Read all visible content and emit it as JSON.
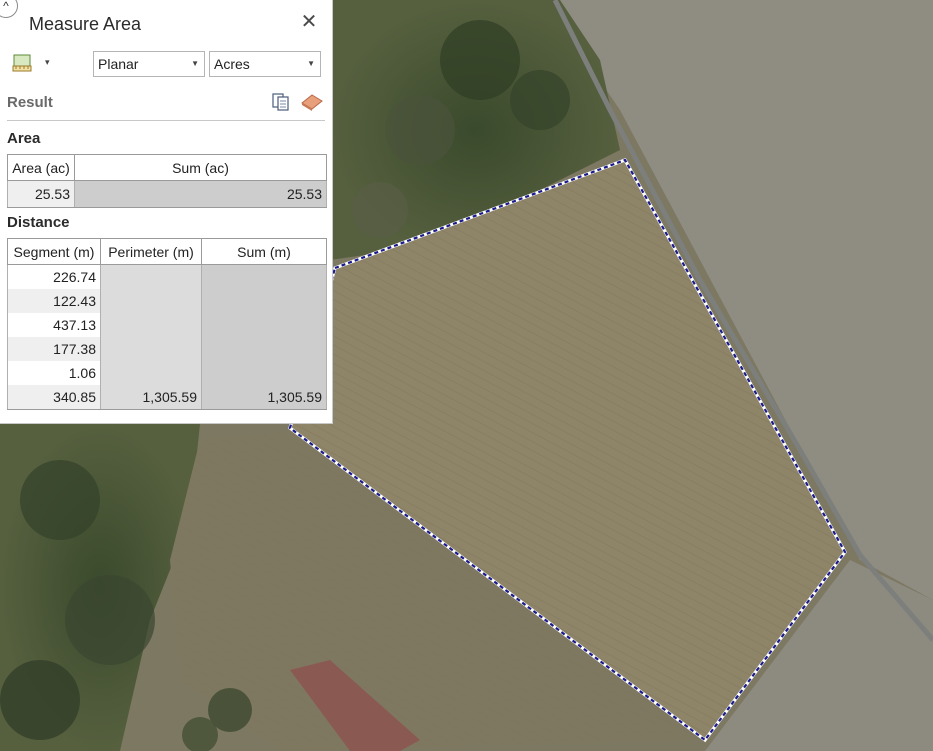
{
  "panel": {
    "title": "Measure Area",
    "close_glyph": "✕",
    "collapse_glyph": "^",
    "tool_icon": "measure-area-tool-icon",
    "method": "Planar",
    "units": "Acres",
    "result_label": "Result",
    "copy_icon": "copy-icon",
    "clear_icon": "eraser-icon"
  },
  "area": {
    "label": "Area",
    "columns": [
      "Area (ac)",
      "Sum (ac)"
    ],
    "rows": [
      {
        "area": "25.53",
        "sum": "25.53"
      }
    ]
  },
  "distance": {
    "label": "Distance",
    "columns": [
      "Segment (m)",
      "Perimeter (m)",
      "Sum (m)"
    ],
    "segments": [
      "226.74",
      "122.43",
      "437.13",
      "177.38",
      "1.06",
      "340.85"
    ],
    "perimeter": "1,305.59",
    "sum": "1,305.59"
  },
  "colors": {
    "measure_line": "#1a1a8c",
    "field": "#8b8266",
    "forest": "#3f4a30"
  }
}
